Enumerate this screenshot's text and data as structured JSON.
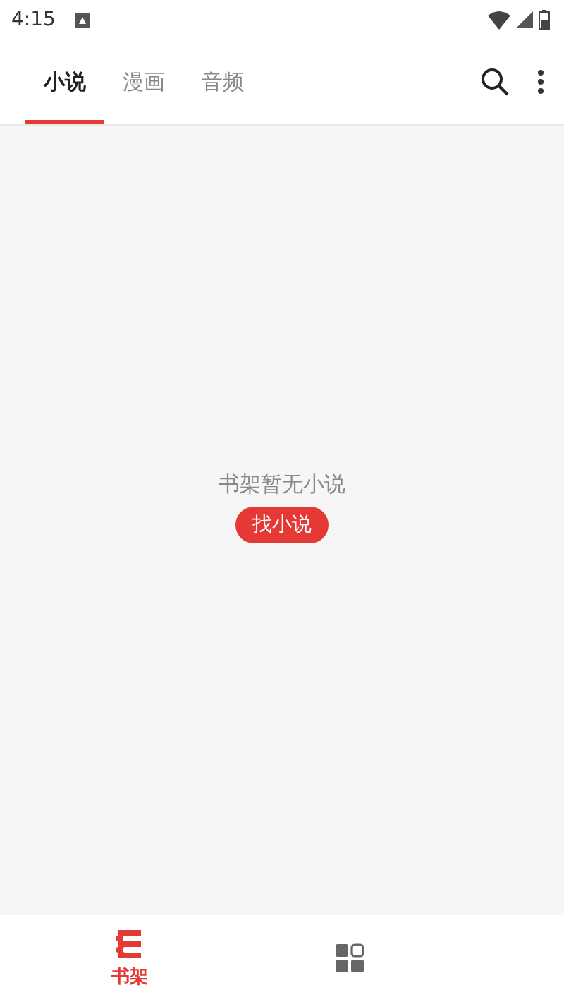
{
  "status_bar": {
    "time": "4:15"
  },
  "tabs": [
    {
      "label": "小说",
      "selected": true
    },
    {
      "label": "漫画",
      "selected": false
    },
    {
      "label": "音频",
      "selected": false
    }
  ],
  "empty_state": {
    "message": "书架暂无小说",
    "button": "找小说"
  },
  "bottom_nav": [
    {
      "kind": "shelf",
      "label": "书架",
      "selected": true
    },
    {
      "kind": "grid",
      "selected": false
    }
  ]
}
